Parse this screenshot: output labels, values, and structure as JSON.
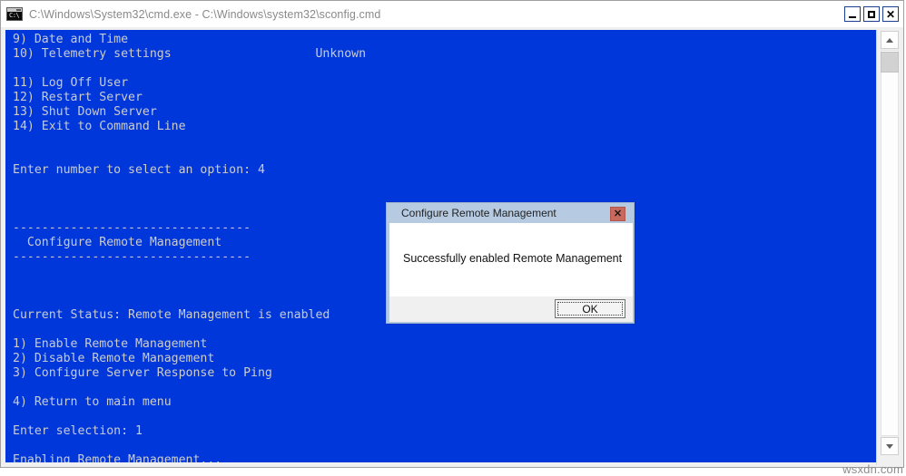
{
  "window": {
    "title": "C:\\Windows\\System32\\cmd.exe - C:\\Windows\\system32\\sconfig.cmd",
    "icon": "cmd-console-icon",
    "icon_prompt": "C:\\",
    "buttons": {
      "minimize": "minimize-button",
      "maximize": "maximize-button",
      "close": "close-button"
    },
    "background_color": "#0037da",
    "text_color": "#ccccce"
  },
  "console": {
    "text": "9) Date and Time\n10) Telemetry settings                    Unknown\n\n11) Log Off User\n12) Restart Server\n13) Shut Down Server\n14) Exit to Command Line\n\n\nEnter number to select an option: 4\n\n\n\n---------------------------------\n  Configure Remote Management\n---------------------------------\n\n\n\nCurrent Status: Remote Management is enabled\n\n1) Enable Remote Management\n2) Disable Remote Management\n3) Configure Server Response to Ping\n\n4) Return to main menu\n\nEnter selection: 1\n\nEnabling Remote Management...",
    "lines": [
      "9) Date and Time",
      "10) Telemetry settings                    Unknown",
      "",
      "11) Log Off User",
      "12) Restart Server",
      "13) Shut Down Server",
      "14) Exit to Command Line",
      "",
      "",
      "Enter number to select an option: 4",
      "",
      "",
      "",
      "---------------------------------",
      "  Configure Remote Management",
      "---------------------------------",
      "",
      "",
      "",
      "Current Status: Remote Management is enabled",
      "",
      "1) Enable Remote Management",
      "2) Disable Remote Management",
      "3) Configure Server Response to Ping",
      "",
      "4) Return to main menu",
      "",
      "Enter selection: 1",
      "",
      "Enabling Remote Management..."
    ],
    "menu_selection_prompt": "Enter number to select an option: 4",
    "selected_option": "4",
    "submenu_title": "Configure Remote Management",
    "current_status": "Current Status: Remote Management is enabled",
    "submenu_items": [
      "1) Enable Remote Management",
      "2) Disable Remote Management",
      "3) Configure Server Response to Ping",
      "4) Return to main menu"
    ],
    "submenu_prompt": "Enter selection: 1",
    "submenu_selection": "1",
    "progress_message": "Enabling Remote Management..."
  },
  "scrollbar": {
    "up_arrow": "scroll-up-arrow-icon",
    "down_arrow": "scroll-down-arrow-icon"
  },
  "dialog": {
    "title": "Configure Remote Management",
    "message": "Successfully enabled Remote Management",
    "close_glyph": "✕",
    "ok_label": "OK",
    "titlebar_color": "#b6cbe2",
    "close_button_color": "#c9685c"
  },
  "watermark": {
    "text": "wsxdn.com"
  }
}
